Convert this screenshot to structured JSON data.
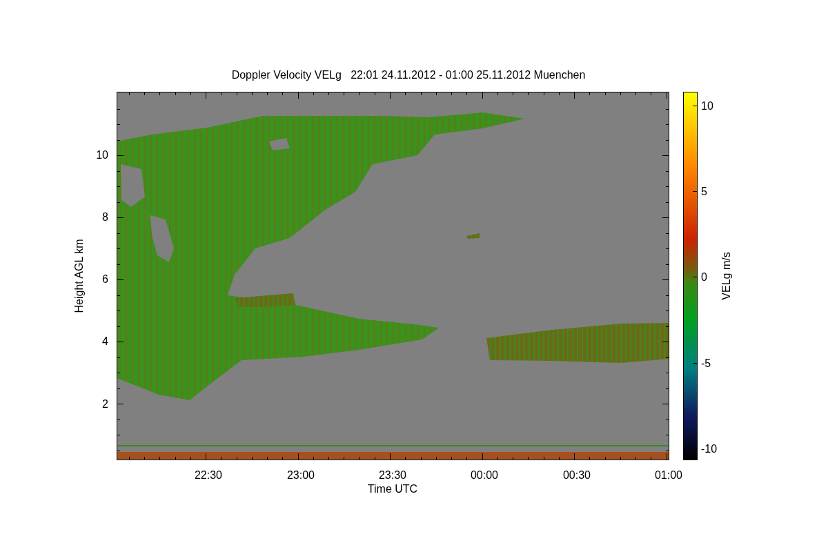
{
  "title": "Doppler Velocity VELg   22:01 24.11.2012 - 01:00 25.11.2012 Muenchen",
  "x_axis": {
    "label": "Time UTC",
    "ticks": [
      "22:30",
      "23:00",
      "23:30",
      "00:00",
      "00:30",
      "01:00"
    ]
  },
  "y_axis": {
    "label": "Height AGL km",
    "ticks": [
      "10",
      "8",
      "6",
      "4",
      "2"
    ]
  },
  "colorbar": {
    "label": "VELg m/s",
    "ticks": [
      "10",
      "5",
      "0",
      "-5",
      "-10"
    ]
  }
}
